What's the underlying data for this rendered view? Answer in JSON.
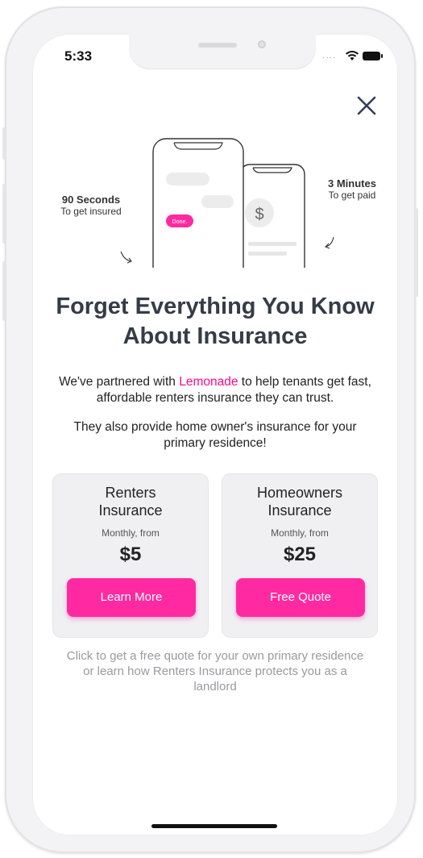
{
  "status_bar": {
    "time": "5:33"
  },
  "illustration": {
    "left_caption": {
      "title": "90 Seconds",
      "subtitle": "To get insured"
    },
    "right_caption": {
      "title": "3 Minutes",
      "subtitle": "To get paid"
    },
    "bubble_text": "Done.",
    "currency_symbol": "$"
  },
  "headline": "Forget Everything You Know About Insurance",
  "intro": {
    "before": "We've partnered with ",
    "brand": "Lemonade",
    "after": " to help tenants get fast, affordable renters insurance they can trust."
  },
  "intro2": "They also provide home owner's insurance for your primary residence!",
  "cards": [
    {
      "title_line1": "Renters",
      "title_line2": "Insurance",
      "subtitle": "Monthly, from",
      "price": "$5",
      "button_label": "Learn More"
    },
    {
      "title_line1": "Homeowners",
      "title_line2": "Insurance",
      "subtitle": "Monthly, from",
      "price": "$25",
      "button_label": "Free Quote"
    }
  ],
  "footnote": "Click to get a free quote for your own primary residence or learn how Renters Insurance protects you as a landlord",
  "colors": {
    "accent": "#ff2aa1",
    "brand_text": "#ff0a8d",
    "headline": "#353c47"
  },
  "icons": {
    "close": "close-icon",
    "wifi": "wifi-icon",
    "battery": "battery-icon"
  }
}
